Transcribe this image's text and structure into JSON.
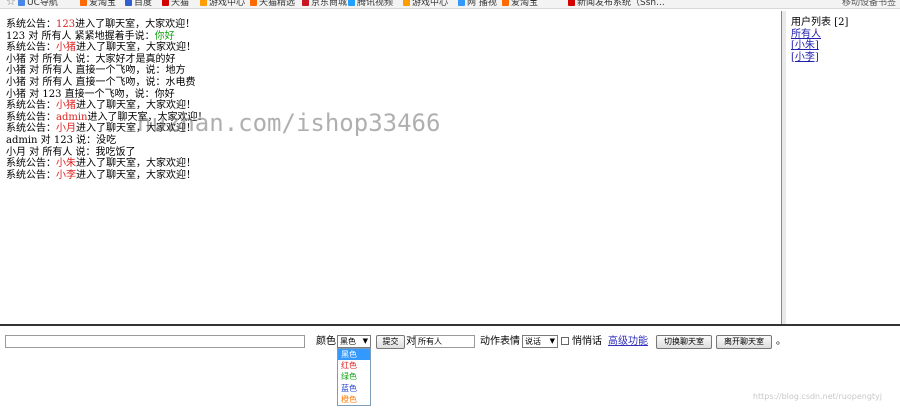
{
  "bookmarks": {
    "items": [
      {
        "label": "UC导航",
        "color": "#4a86e8"
      },
      {
        "label": "爱淘宝",
        "color": "#ff6a00"
      },
      {
        "label": "百度",
        "color": "#3060d0"
      },
      {
        "label": "天猫",
        "color": "#d40000"
      },
      {
        "label": "游戏中心",
        "color": "#ff9c00"
      },
      {
        "label": "天猫精选",
        "color": "#ff6a00"
      },
      {
        "label": "京东商城",
        "color": "#c81623"
      },
      {
        "label": "腾讯视频",
        "color": "#20a0ff"
      },
      {
        "label": "游戏中心",
        "color": "#ff9c00"
      },
      {
        "label": "网 播视",
        "color": "#3399ff"
      },
      {
        "label": "爱淘宝",
        "color": "#ff6a00"
      },
      {
        "label": "新闻发布系统（Ssh...",
        "color": "#d40000"
      }
    ],
    "right_label": "移动设备书签"
  },
  "chat": {
    "messages": [
      {
        "parts": [
          {
            "t": "系统公告："
          },
          {
            "t": "123",
            "c": "red"
          },
          {
            "t": "进入了聊天室，大家欢迎！"
          }
        ]
      },
      {
        "parts": [
          {
            "t": "123 对 所有人 紧紧地握着手说："
          },
          {
            "t": "你好",
            "c": "green"
          }
        ]
      },
      {
        "parts": [
          {
            "t": "系统公告："
          },
          {
            "t": "小猪",
            "c": "red"
          },
          {
            "t": "进入了聊天室，大家欢迎！"
          }
        ]
      },
      {
        "parts": [
          {
            "t": "小猪 对 所有人 说：大家好才是真的好"
          }
        ]
      },
      {
        "parts": [
          {
            "t": "小猪 对 所有人 直接一个飞吻，说：地方"
          }
        ]
      },
      {
        "parts": [
          {
            "t": "小猪 对 所有人 直接一个飞吻，说：水电费"
          }
        ]
      },
      {
        "parts": [
          {
            "t": "小猪 对 123 直接一个飞吻，说：你好"
          }
        ]
      },
      {
        "parts": [
          {
            "t": "系统公告："
          },
          {
            "t": "小猪",
            "c": "red"
          },
          {
            "t": "进入了聊天室，大家欢迎！"
          }
        ]
      },
      {
        "parts": [
          {
            "t": "系统公告："
          },
          {
            "t": "admin",
            "c": "red"
          },
          {
            "t": "进入了聊天室，大家欢迎！"
          }
        ]
      },
      {
        "parts": [
          {
            "t": "系统公告："
          },
          {
            "t": "小月",
            "c": "red"
          },
          {
            "t": "进入了聊天室，大家欢迎！"
          }
        ]
      },
      {
        "parts": [
          {
            "t": "admin 对 123 说：没吃"
          }
        ]
      },
      {
        "parts": [
          {
            "t": "小月 对 所有人 说：我吃饭了"
          }
        ]
      },
      {
        "parts": [
          {
            "t": "系统公告："
          },
          {
            "t": "小朱",
            "c": "red"
          },
          {
            "t": "进入了聊天室，大家欢迎！"
          }
        ]
      },
      {
        "parts": [
          {
            "t": "系统公告："
          },
          {
            "t": "小李",
            "c": "red"
          },
          {
            "t": "进入了聊天室，大家欢迎！"
          }
        ]
      }
    ]
  },
  "user_list": {
    "title": "用户列表 [2]",
    "items": [
      "所有人",
      "[小朱]",
      "[小李]"
    ]
  },
  "input_bar": {
    "message_value": "",
    "color_label": "颜色",
    "color_selected": "黑色",
    "submit_label": "提交",
    "to_label": "对",
    "target_value": "所有人",
    "action_label": "动作表情",
    "action_selected": "说话",
    "whisper_label": "悄悄话",
    "advanced_label": "高级功能",
    "switch_room_label": "切换聊天室",
    "leave_room_label": "离开聊天室",
    "trailing_dot": "。"
  },
  "color_dropdown": {
    "options": [
      {
        "label": "黑色",
        "color": "#000000"
      },
      {
        "label": "红色",
        "color": "#e02020"
      },
      {
        "label": "绿色",
        "color": "#12a012"
      },
      {
        "label": "蓝色",
        "color": "#2040d0"
      },
      {
        "label": "橙色",
        "color": "#ff7a00"
      }
    ],
    "selected_index": 0
  },
  "watermark": "huzhan.com/ishop33466",
  "footer_watermark": "https://blog.csdn.net/ruopengtyj"
}
